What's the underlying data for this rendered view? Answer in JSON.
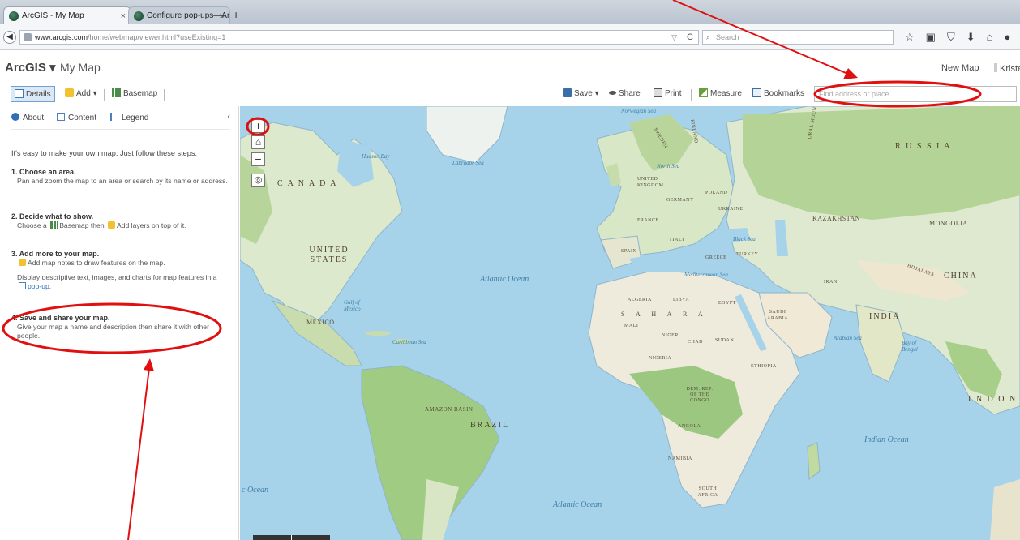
{
  "browser": {
    "tabs": [
      {
        "title": "ArcGIS - My Map",
        "active": true
      },
      {
        "title": "Configure pop-ups—ArcGI...",
        "active": false
      }
    ],
    "new_tab_label": "+",
    "url_host": "www.arcgis.com",
    "url_path": "/home/webmap/viewer.html?useExisting=1",
    "search_placeholder": "Search",
    "nav_icons": [
      "star-icon",
      "clipboard-icon",
      "pocket-icon",
      "download-icon",
      "home-icon",
      "chat-icon"
    ]
  },
  "app": {
    "brand": "ArcGIS ▾",
    "map_title": "My Map",
    "new_map_label": "New Map",
    "user_name": "Kriste"
  },
  "toolbar": {
    "details_label": "Details",
    "add_label": "Add ▾",
    "basemap_label": "Basemap",
    "save_label": "Save ▾",
    "share_label": "Share",
    "print_label": "Print",
    "measure_label": "Measure",
    "bookmarks_label": "Bookmarks",
    "find_placeholder": "Find address or place"
  },
  "panel": {
    "tabs": {
      "about": "About",
      "content": "Content",
      "legend": "Legend"
    },
    "collapse_glyph": "‹",
    "intro": "It's easy to make your own map. Just follow these steps:",
    "steps": [
      {
        "title": "1. Choose an area.",
        "body": "Pan and zoom the map to an area or search by its name or address."
      },
      {
        "title": "2. Decide what to show.",
        "body_a": "Choose a",
        "body_b": "Basemap then",
        "body_c": "Add layers on top of it."
      },
      {
        "title": "3. Add more to your map.",
        "body": "Add map notes to draw features on the map.",
        "body2_a": "Display descriptive text, images, and charts for map features in a",
        "body2_link": "pop-up."
      },
      {
        "title": "4. Save and share your map.",
        "body": "Give your map a name and description then share it with other people."
      }
    ]
  },
  "map": {
    "zoom_in": "+",
    "zoom_out": "−",
    "labels": {
      "norwegian_sea": "Norwegian Sea",
      "hudson_bay": "Hudson Bay",
      "labrador_sea": "Labrador Sea",
      "canada": "C A N A D A",
      "united_states": "UNITED STATES",
      "north_sea": "North Sea",
      "united_kingdom": "UNITED KINGDOM",
      "germany": "GERMANY",
      "poland": "POLAND",
      "ukraine": "UKRAINE",
      "france": "FRANCE",
      "italy": "ITALY",
      "spain": "SPAIN",
      "greece": "GREECE",
      "turkey": "TURKEY",
      "black_sea": "Black Sea",
      "mediterranean": "Mediterranean Sea",
      "russia": "R U S S I A",
      "kazakhstan": "KAZAKHSTAN",
      "mongolia": "MONGOLIA",
      "china": "CHINA",
      "india": "INDIA",
      "iran": "IRAN",
      "atlantic_north": "Atlantic Ocean",
      "atlantic_south": "Atlantic Ocean",
      "gulf_of_mexico": "Gulf of Mexico",
      "mexico": "MEXICO",
      "caribbean": "Caribbean Sea",
      "algeria": "ALGERIA",
      "libya": "LIBYA",
      "egypt": "EGYPT",
      "sahara": "S A H A R A",
      "saudi_arabia": "SAUDI ARABIA",
      "mali": "MALI",
      "niger": "NIGER",
      "chad": "CHAD",
      "sudan": "SUDAN",
      "nigeria": "NIGERIA",
      "ethiopia": "ETHIOPIA",
      "drc": "DEM. REP. OF THE CONGO",
      "angola": "ANGOLA",
      "namibia": "NAMIBIA",
      "south_africa": "SOUTH AFRICA",
      "amazon_basin": "AMAZON BASIN",
      "brazil": "BRAZIL",
      "indian_ocean": "Indian Ocean",
      "arabian_sea": "Arabian Sea",
      "bay_of_bengal": "Bay of Bengal",
      "indonesia": "I N D O N",
      "pacific_ocean": "c Ocean",
      "ural": "URAL MOUNTAINS",
      "himalaya": "HIMALAYA",
      "finland": "FINLAND",
      "sweden": "SWEDEN"
    }
  },
  "colors": {
    "annotation": "#e01010",
    "water": "#a7d3ea",
    "land_green": "#9cc98b",
    "accent_blue": "#2a6ebd"
  }
}
